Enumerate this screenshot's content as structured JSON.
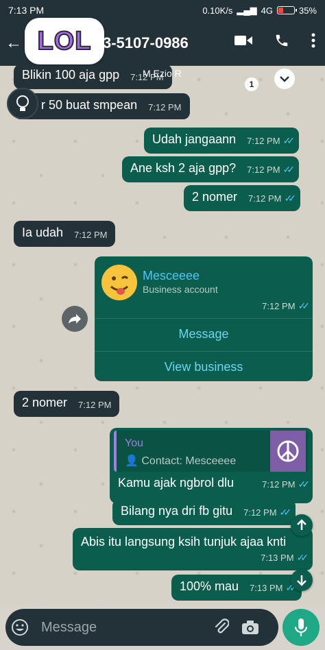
{
  "statusbar": {
    "time": "7:13 PM",
    "speed": "0.10K/s",
    "network": "4G",
    "battery": "35%",
    "battery_level": 0.35
  },
  "header": {
    "contact": "3-5107-0986",
    "sticker_text": "LOL"
  },
  "chat": {
    "quoted_sender": "M Ezio R",
    "unread_badge": "1",
    "messages": [
      {
        "dir": "in",
        "text": "Blikin 100 aja gpp",
        "time": "7:12 PM"
      },
      {
        "dir": "in",
        "text": "r 50 buat smpean",
        "time": "7:12 PM"
      },
      {
        "dir": "out",
        "text": "Udah jangaann",
        "time": "7:12 PM"
      },
      {
        "dir": "out",
        "text": "Ane ksh 2 aja gpp?",
        "time": "7:12 PM"
      },
      {
        "dir": "out",
        "text": "2 nomer",
        "time": "7:12 PM"
      },
      {
        "dir": "in",
        "text": "Ia udah",
        "time": "7:12 PM"
      },
      {
        "dir": "in",
        "text": "2 nomer",
        "time": "7:12 PM"
      },
      {
        "dir": "out",
        "text": "Bilang nya dri fb gitu",
        "time": "7:12 PM"
      },
      {
        "dir": "out",
        "text": "Abis itu langsung ksih tunjuk ajaa knti",
        "time": "7:13 PM"
      },
      {
        "dir": "out",
        "text": "100% mau",
        "time": "7:13 PM"
      }
    ],
    "business_card": {
      "name": "Mesceeee",
      "subtitle": "Business account",
      "time": "7:12 PM",
      "button_message": "Message",
      "button_view": "View business"
    },
    "quoted_reply": {
      "quote_author": "You",
      "quote_text": "Contact: Mesceeee",
      "reply_text": "Kamu ajak ngbrol dlu",
      "time": "7:12 PM"
    }
  },
  "input": {
    "placeholder": "Message"
  },
  "colors": {
    "incoming_bubble": "#233238",
    "outgoing_bubble": "#0b5e4e",
    "read_tick": "#4fc3f7",
    "mic_button": "#1fa885"
  }
}
